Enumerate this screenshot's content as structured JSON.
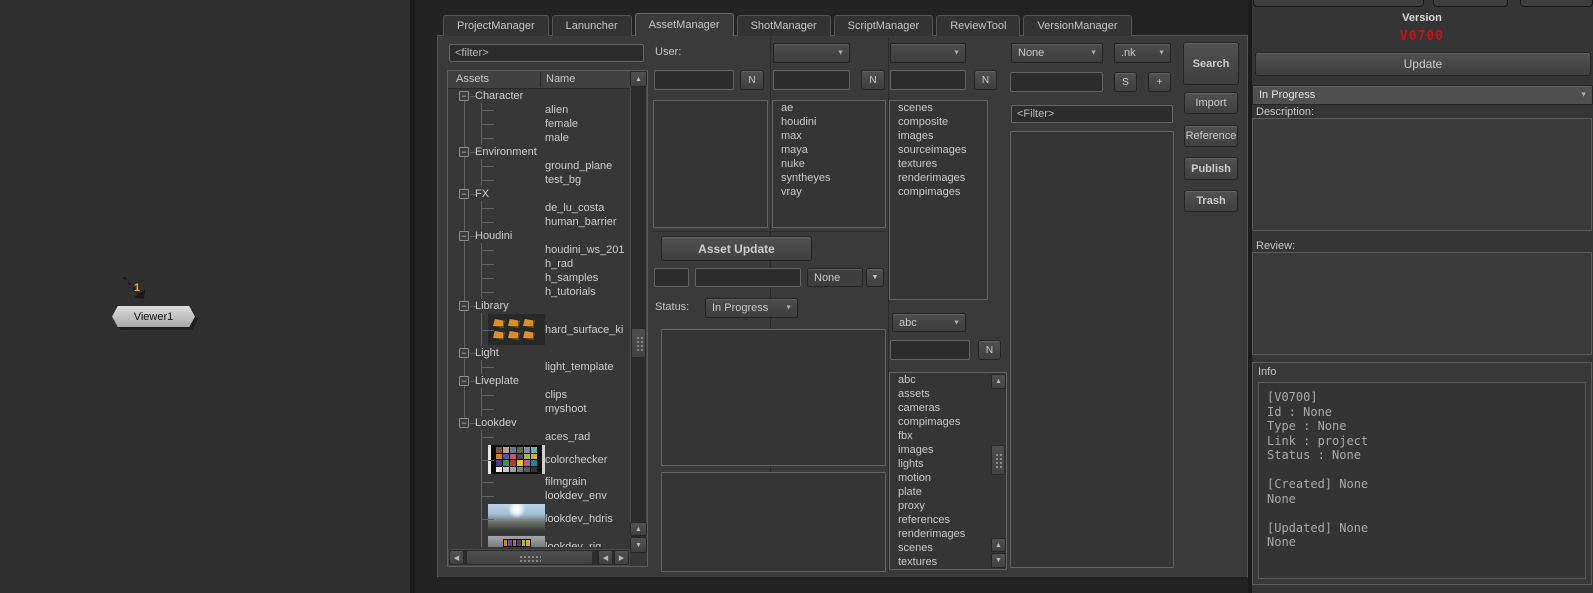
{
  "colors": {
    "version_red": "#c01518",
    "selection_orange": "#e8a33d",
    "thumb_orange": "#d98f2e",
    "panel_bg": "#3a3a3a",
    "node_fill": "#cccccc"
  },
  "icons": {
    "dropdown_arrow": "▼",
    "scroll_up": "▲",
    "scroll_down": "▼",
    "scroll_left": "◀",
    "scroll_right": "▶",
    "expander_expanded": "−"
  },
  "node_graph": {
    "node_label": "Viewer1",
    "connector_label": "1"
  },
  "tabs": [
    {
      "label": "ProjectManager",
      "active": false
    },
    {
      "label": "Lanuncher",
      "active": false
    },
    {
      "label": "AssetManager",
      "active": true
    },
    {
      "label": "ShotManager",
      "active": false
    },
    {
      "label": "ScriptManager",
      "active": false
    },
    {
      "label": "ReviewTool",
      "active": false
    },
    {
      "label": "VersionManager",
      "active": false
    }
  ],
  "asset_browser": {
    "filter_text": "<filter>",
    "columns": {
      "assets": "Assets",
      "name": "Name"
    },
    "rows": [
      {
        "type": "cat",
        "label": "Character"
      },
      {
        "type": "item",
        "label": "alien"
      },
      {
        "type": "item",
        "label": "female"
      },
      {
        "type": "item",
        "label": "male"
      },
      {
        "type": "cat",
        "label": "Environment"
      },
      {
        "type": "item",
        "label": "ground_plane"
      },
      {
        "type": "item",
        "label": "test_bg"
      },
      {
        "type": "cat",
        "label": "FX"
      },
      {
        "type": "item",
        "label": "de_lu_costa"
      },
      {
        "type": "item",
        "label": "human_barrier"
      },
      {
        "type": "cat",
        "label": "Houdini"
      },
      {
        "type": "item",
        "label": "houdini_ws_201"
      },
      {
        "type": "item",
        "label": "h_rad"
      },
      {
        "type": "item",
        "label": "h_samples"
      },
      {
        "type": "item",
        "label": "h_tutorials"
      },
      {
        "type": "cat",
        "label": "Library"
      },
      {
        "type": "item",
        "label": "hard_surface_ki",
        "thumb": "hardsurface"
      },
      {
        "type": "cat",
        "label": "Light"
      },
      {
        "type": "item",
        "label": "light_template"
      },
      {
        "type": "cat",
        "label": "Liveplate"
      },
      {
        "type": "item",
        "label": "clips"
      },
      {
        "type": "item",
        "label": "myshoot"
      },
      {
        "type": "cat",
        "label": "Lookdev"
      },
      {
        "type": "item",
        "label": "aces_rad"
      },
      {
        "type": "item",
        "label": "colorchecker",
        "thumb": "colorchecker"
      },
      {
        "type": "item",
        "label": "filmgrain"
      },
      {
        "type": "item",
        "label": "lookdev_env"
      },
      {
        "type": "item",
        "label": "lookdev_hdris",
        "thumb": "hdri"
      },
      {
        "type": "item",
        "label": "lookdev_rig",
        "thumb": "rig"
      }
    ]
  },
  "labels": {
    "user": "User:",
    "status": "Status:",
    "n": "N",
    "s": "S",
    "plus": "+"
  },
  "software_list": [
    "ae",
    "houdini",
    "max",
    "maya",
    "nuke",
    "syntheyes",
    "vray"
  ],
  "folders_list": [
    "scenes",
    "composite",
    "images",
    "sourceimages",
    "textures",
    "renderimages",
    "compimages"
  ],
  "asset_update": {
    "button": "Asset Update",
    "version_dropdown": "None",
    "status_value": "In Progress"
  },
  "type_section": {
    "dropdown_value": "abc",
    "list": [
      "abc",
      "assets",
      "cameras",
      "compimages",
      "fbx",
      "images",
      "lights",
      "motion",
      "plate",
      "proxy",
      "references",
      "renderimages",
      "scenes",
      "textures"
    ]
  },
  "search_section": {
    "kind_dropdown": "None",
    "ext_dropdown": ".nk",
    "filter_text": "<Filter>"
  },
  "action_buttons": {
    "search": "Search",
    "import": "Import",
    "reference": "Reference",
    "publish": "Publish",
    "trash": "Trash"
  },
  "version_panel": {
    "title": "Version",
    "version": "V0700",
    "update_button": "Update",
    "status_value": "In Progress",
    "description_label": "Description:",
    "review_label": "Review:",
    "info_title": "Info",
    "info_text": "[V0700]\nId : None\nType : None\nLink : project\nStatus : None\n\n[Created] None\nNone\n\n[Updated] None\nNone"
  },
  "colorchecker_palette": [
    "#7a5547",
    "#c79a85",
    "#647a9c",
    "#5a6e3f",
    "#8a87b5",
    "#63b8a6",
    "#d6802c",
    "#4a5aa5",
    "#c25a64",
    "#5c3c6e",
    "#9fbd3f",
    "#e2a62c",
    "#3a3e99",
    "#3f9447",
    "#b03a3e",
    "#e6c722",
    "#bb5795",
    "#1687a7",
    "#f2f2f0",
    "#c9c9c9",
    "#a2a2a2",
    "#7b7b7a",
    "#575757",
    "#333333"
  ]
}
